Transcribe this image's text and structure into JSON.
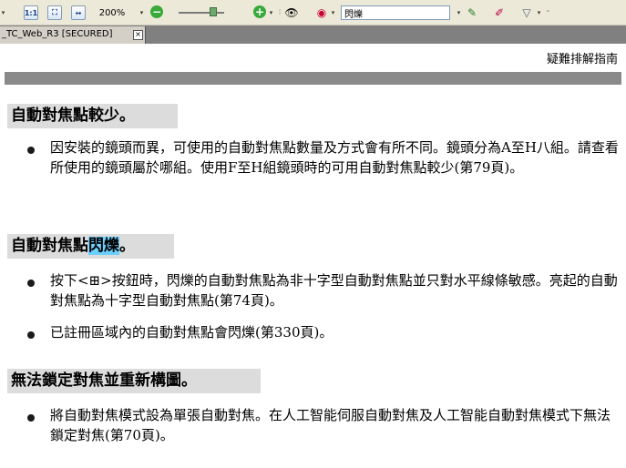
{
  "toolbar": {
    "zoom": "200%",
    "search_value": "閃爍",
    "icons": [
      "actual-size-icon",
      "fit-page-icon",
      "fit-width-icon",
      "zoom-out-icon",
      "zoom-in-icon",
      "binoculars-icon",
      "user-icon",
      "tools-icon",
      "pen-icon",
      "highlighter-icon"
    ]
  },
  "tab": {
    "title": "_TC_Web_R3 [SECURED]"
  },
  "document": {
    "header": "疑難排解指南",
    "sections": [
      {
        "title": "自動對焦點較少。",
        "bullets": [
          "因安裝的鏡頭而異，可使用的自動對焦點數量及方式會有所不同。鏡頭分為A至H八組。請查看所使用的鏡頭屬於哪組。使用F至H組鏡頭時的可用自動對焦點較少(第79頁)。"
        ]
      },
      {
        "title_pre": "自動對焦點",
        "title_highlight": "閃爍",
        "title_post": "。",
        "bullets": [
          "按下<⊞>按鈕時，閃爍的自動對焦點為非十字型自動對焦點並只對水平線條敏感。亮起的自動對焦點為十字型自動對焦點(第74頁)。",
          "已註冊區域內的自動對焦點會閃爍(第330頁)。"
        ]
      },
      {
        "title": "無法鎖定對焦並重新構圖。",
        "bullets": [
          "將自動對焦模式設為單張自動對焦。在人工智能伺服自動對焦及人工智能自動對焦模式下無法鎖定對焦(第70頁)。"
        ]
      }
    ]
  },
  "colors": {
    "highlight": "#6cd0ff",
    "section_bg": "#dcdcdc",
    "rule": "#8a8a8a"
  }
}
